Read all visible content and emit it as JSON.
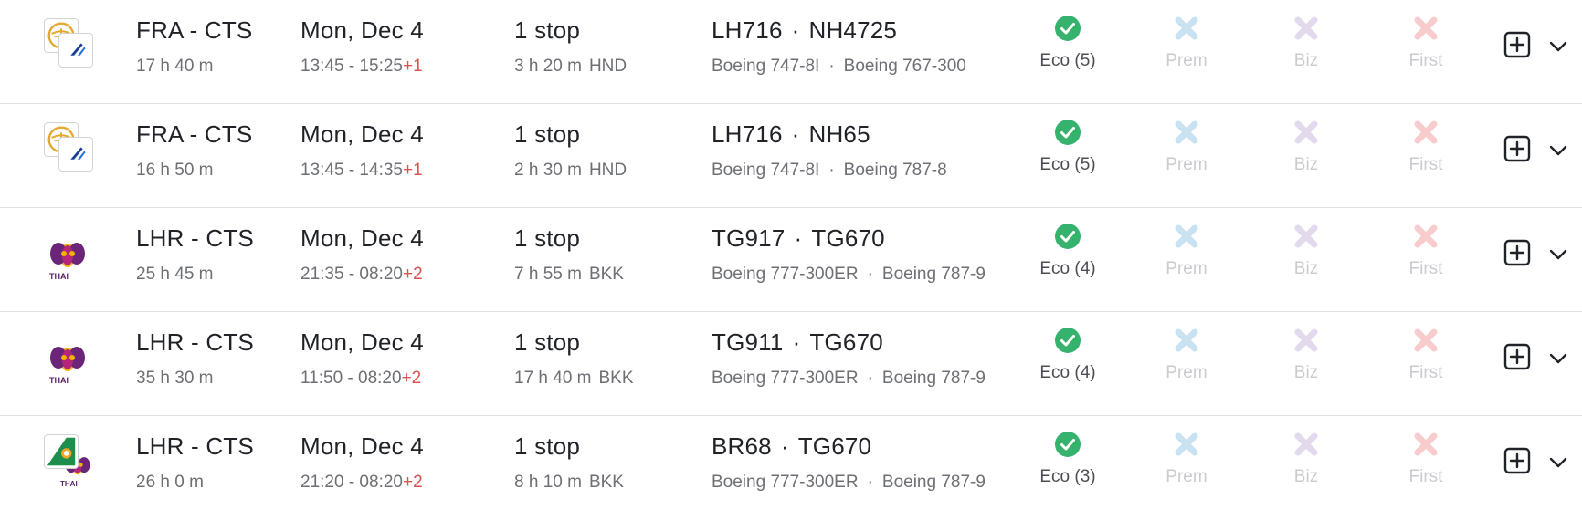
{
  "colors": {
    "check_green": "#35b26b",
    "prem_x": "#c8e2f2",
    "biz_x": "#e3d9ec",
    "first_x": "#f8cccc",
    "plus_day": "#d9534f"
  },
  "flights": [
    {
      "logo": "lufthansa-ana",
      "route": "FRA - CTS",
      "duration": "17 h 40 m",
      "date": "Mon, Dec 4",
      "time": "13:45 - 15:25",
      "day_offset": "+1",
      "stops": "1 stop",
      "layover_time": "3 h 20 m",
      "layover_airport": "HND",
      "flight_a": "LH716",
      "flight_b": "NH4725",
      "aircraft_a": "Boeing 747-8I",
      "aircraft_b": "Boeing 767-300",
      "eco": "Eco (5)",
      "prem": "Prem",
      "biz": "Biz",
      "first": "First"
    },
    {
      "logo": "lufthansa-ana",
      "route": "FRA - CTS",
      "duration": "16 h 50 m",
      "date": "Mon, Dec 4",
      "time": "13:45 - 14:35",
      "day_offset": "+1",
      "stops": "1 stop",
      "layover_time": "2 h 30 m",
      "layover_airport": "HND",
      "flight_a": "LH716",
      "flight_b": "NH65",
      "aircraft_a": "Boeing 747-8I",
      "aircraft_b": "Boeing 787-8",
      "eco": "Eco (5)",
      "prem": "Prem",
      "biz": "Biz",
      "first": "First"
    },
    {
      "logo": "thai",
      "route": "LHR - CTS",
      "duration": "25 h 45 m",
      "date": "Mon, Dec 4",
      "time": "21:35 - 08:20",
      "day_offset": "+2",
      "stops": "1 stop",
      "layover_time": "7 h 55 m",
      "layover_airport": "BKK",
      "flight_a": "TG917",
      "flight_b": "TG670",
      "aircraft_a": "Boeing 777-300ER",
      "aircraft_b": "Boeing 787-9",
      "eco": "Eco (4)",
      "prem": "Prem",
      "biz": "Biz",
      "first": "First"
    },
    {
      "logo": "thai",
      "route": "LHR - CTS",
      "duration": "35 h 30 m",
      "date": "Mon, Dec 4",
      "time": "11:50 - 08:20",
      "day_offset": "+2",
      "stops": "1 stop",
      "layover_time": "17 h 40 m",
      "layover_airport": "BKK",
      "flight_a": "TG911",
      "flight_b": "TG670",
      "aircraft_a": "Boeing 777-300ER",
      "aircraft_b": "Boeing 787-9",
      "eco": "Eco (4)",
      "prem": "Prem",
      "biz": "Biz",
      "first": "First"
    },
    {
      "logo": "eva-thai",
      "route": "LHR - CTS",
      "duration": "26 h 0 m",
      "date": "Mon, Dec 4",
      "time": "21:20 - 08:20",
      "day_offset": "+2",
      "stops": "1 stop",
      "layover_time": "8 h 10 m",
      "layover_airport": "BKK",
      "flight_a": "BR68",
      "flight_b": "TG670",
      "aircraft_a": "Boeing 777-300ER",
      "aircraft_b": "Boeing 787-9",
      "eco": "Eco (3)",
      "prem": "Prem",
      "biz": "Biz",
      "first": "First"
    }
  ],
  "thai_wordmark": "THAI"
}
